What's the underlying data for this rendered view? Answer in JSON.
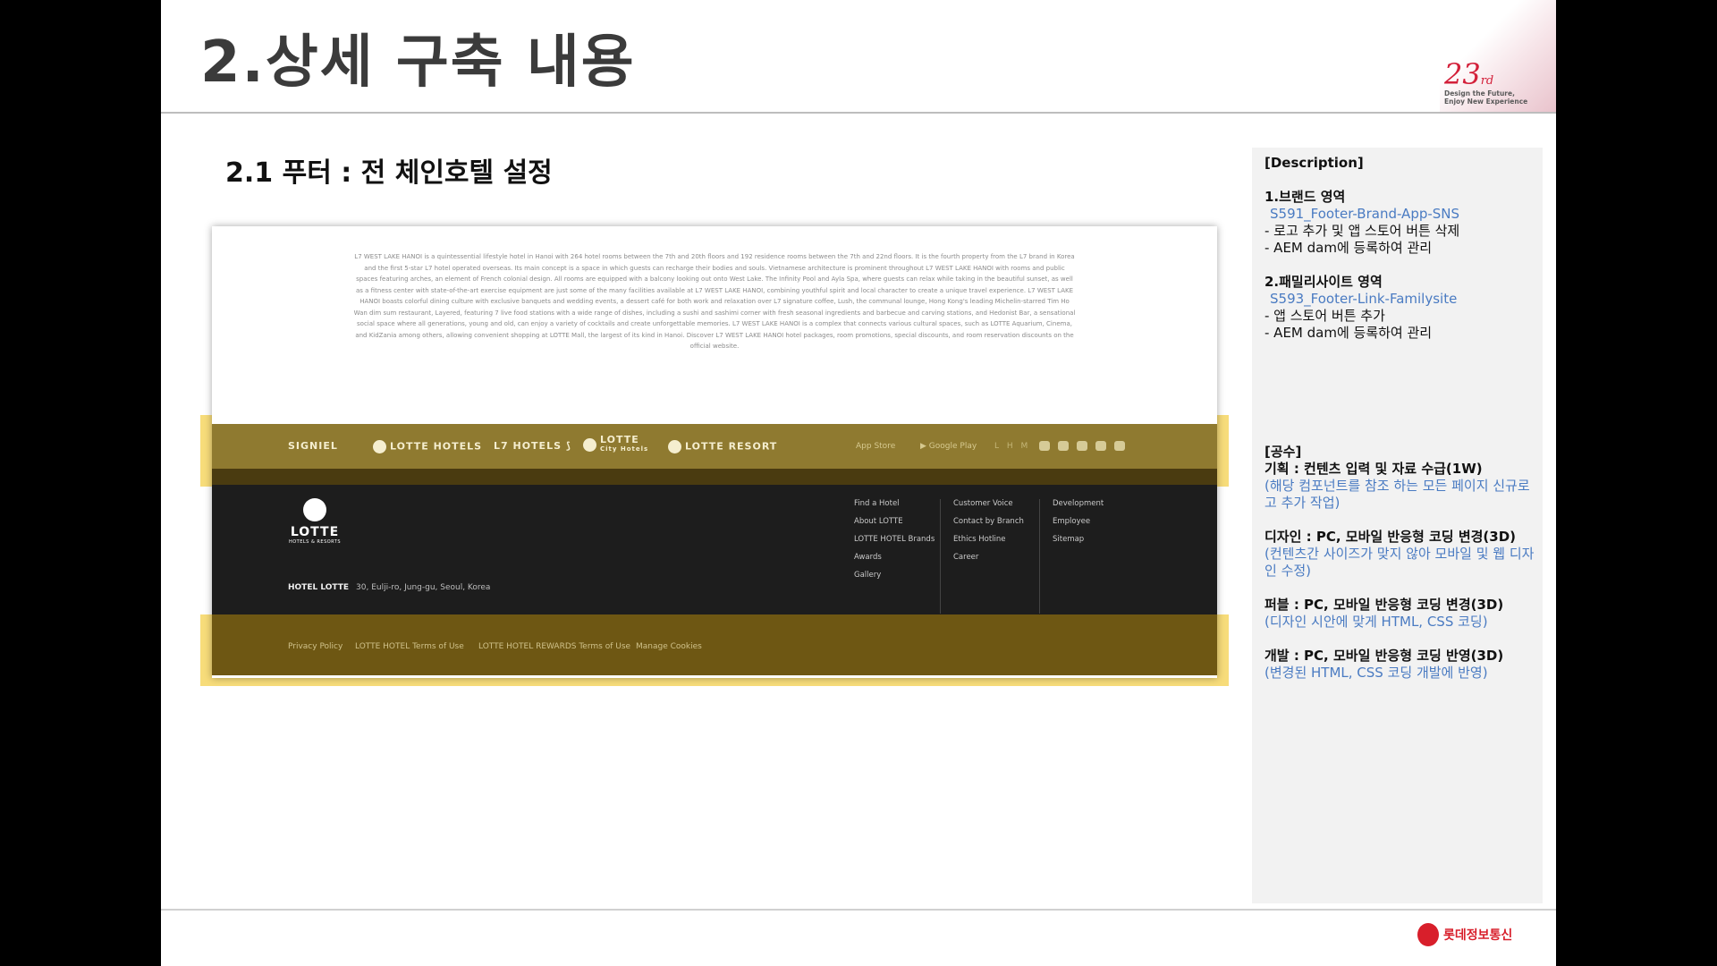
{
  "slide": {
    "title": "2.상세 구축 내용",
    "subtitle": "2.1 푸터 : 전 체인호텔 설정",
    "badge_number": "23",
    "badge_suffix": "rd",
    "badge_line1": "Design the Future,",
    "badge_line2": "Enjoy New Experience",
    "company_name": "롯데정보통신"
  },
  "screenshot": {
    "intro_text": "L7 WEST LAKE HANOI is a quintessential lifestyle hotel in Hanoi with 264 hotel rooms between the 7th and 20th floors and 192 residence rooms between the 7th and 22nd floors. It is the fourth property from the L7 brand in Korea and the first 5-star L7 hotel operated overseas. Its main concept is a space in which guests can recharge their bodies and souls. Vietnamese architecture is prominent throughout L7 WEST LAKE HANOI with rooms and public spaces featuring arches, an element of French colonial design. All rooms are equipped with a balcony looking out onto West Lake. The Infinity Pool and Ayla Spa, where guests can relax while taking in the beautiful sunset, as well as a fitness center with state-of-the-art exercise equipment are just some of the many facilities available at L7 WEST LAKE HANOI, combining youthful spirit and local character to create a unique travel experience. L7 WEST LAKE HANOI boasts colorful dining culture with exclusive banquets and wedding events, a dessert café for both work and relaxation over L7 signature coffee, Lush, the communal lounge, Hong Kong's leading Michelin-starred Tim Ho Wan dim sum restaurant, Layered, featuring 7 live food stations with a wide range of dishes, including a sushi and sashimi corner with fresh seasonal ingredients and barbecue and carving stations, and Hedonist Bar, a sensational social space where all generations, young and old, can enjoy a variety of cocktails and create unforgettable memories. L7 WEST LAKE HANOI is a complex that connects various cultural spaces, such as LOTTE Aquarium, Cinema, and KidZania among others, allowing convenient shopping at LOTTE Mall, the largest of its kind in Hanoi. Discover L7 WEST LAKE HANOI hotel packages, room promotions, special discounts, and room reservation discounts on the official website.",
    "brands": {
      "signiel": "SIGNIEL",
      "lotte_hotels": "LOTTE HOTELS",
      "l7_hotels": "L7 HOTELS",
      "city_hotels_top": "LOTTE",
      "city_hotels_bottom": "City Hotels",
      "lotte_resort": "LOTTE RESORT"
    },
    "stores": {
      "app_store": "App Store",
      "google_play": "Google Play"
    },
    "lhm": "L H M",
    "footer_logo": {
      "name": "LOTTE",
      "sub": "HOTELS & RESORTS"
    },
    "address": {
      "label": "HOTEL LOTTE",
      "value": "30, Eulji-ro, Jung-gu, Seoul, Korea"
    },
    "links_col1": [
      "Find a Hotel",
      "About LOTTE",
      "LOTTE HOTEL Brands",
      "Awards",
      "Gallery"
    ],
    "links_col2": [
      "Customer Voice",
      "Contact by Branch",
      "Ethics Hotline",
      "Career"
    ],
    "links_col3": [
      "Development",
      "Employee",
      "Sitemap"
    ],
    "legal": [
      "Privacy Policy",
      "LOTTE HOTEL Terms of Use",
      "LOTTE HOTEL REWARDS Terms of Use",
      "Manage Cookies"
    ]
  },
  "description": {
    "header": "[Description]",
    "s1_title": "1.브랜드 영역",
    "s1_code": "S591_Footer-Brand-App-SNS",
    "s1_line1": "- 로고 추가 및 앱 스토어 버튼 삭제",
    "s1_line2": "- AEM dam에 등록하여 관리",
    "s2_title": "2.패밀리사이트 영역",
    "s2_code": "S593_Footer-Link-Familysite",
    "s2_line1": "- 앱 스토어 버튼 추가",
    "s2_line2": "- AEM dam에 등록하여 관리",
    "effort_header": "[공수]",
    "plan_title": "기획 : 컨텐츠 입력 및 자료 수급(1W)",
    "plan_note": "(해당 컴포넌트를 참조 하는 모든 페이지 신규로고 추가 작업)",
    "design_title": "디자인 : PC, 모바일 반응형 코딩 변경(3D)",
    "design_note": "(컨텐츠간 사이즈가 맞지 않아 모바일 및 웹 디자인 수정)",
    "publish_title": "퍼블 : PC, 모바일 반응형 코딩 변경(3D)",
    "publish_note": "(디자인 시안에 맞게 HTML, CSS 코딩)",
    "dev_title": "개발 : PC, 모바일 반응형 코딩 반영(3D)",
    "dev_note": "(변경된 HTML, CSS 코딩 개발에 반영)"
  }
}
